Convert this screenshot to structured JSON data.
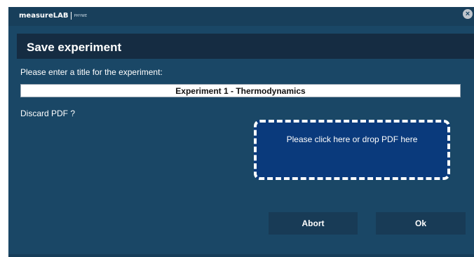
{
  "app": {
    "brand_name": "measureLAB",
    "brand_sub": "PHYWE"
  },
  "dialog": {
    "title": "Save experiment",
    "prompt": "Please enter a title for the experiment:",
    "title_value": "Experiment 1 - Thermodynamics",
    "discard_label": "Discard PDF ?",
    "drop_zone_text": "Please click here or drop PDF here",
    "abort_label": "Abort",
    "ok_label": "Ok"
  },
  "icons": {
    "close": "close-icon"
  },
  "colors": {
    "window_bg": "#1a4766",
    "header_bg": "#152c42",
    "drop_zone_bg": "#0a3a7c",
    "button_bg": "#183b56",
    "text": "#ffffff"
  }
}
